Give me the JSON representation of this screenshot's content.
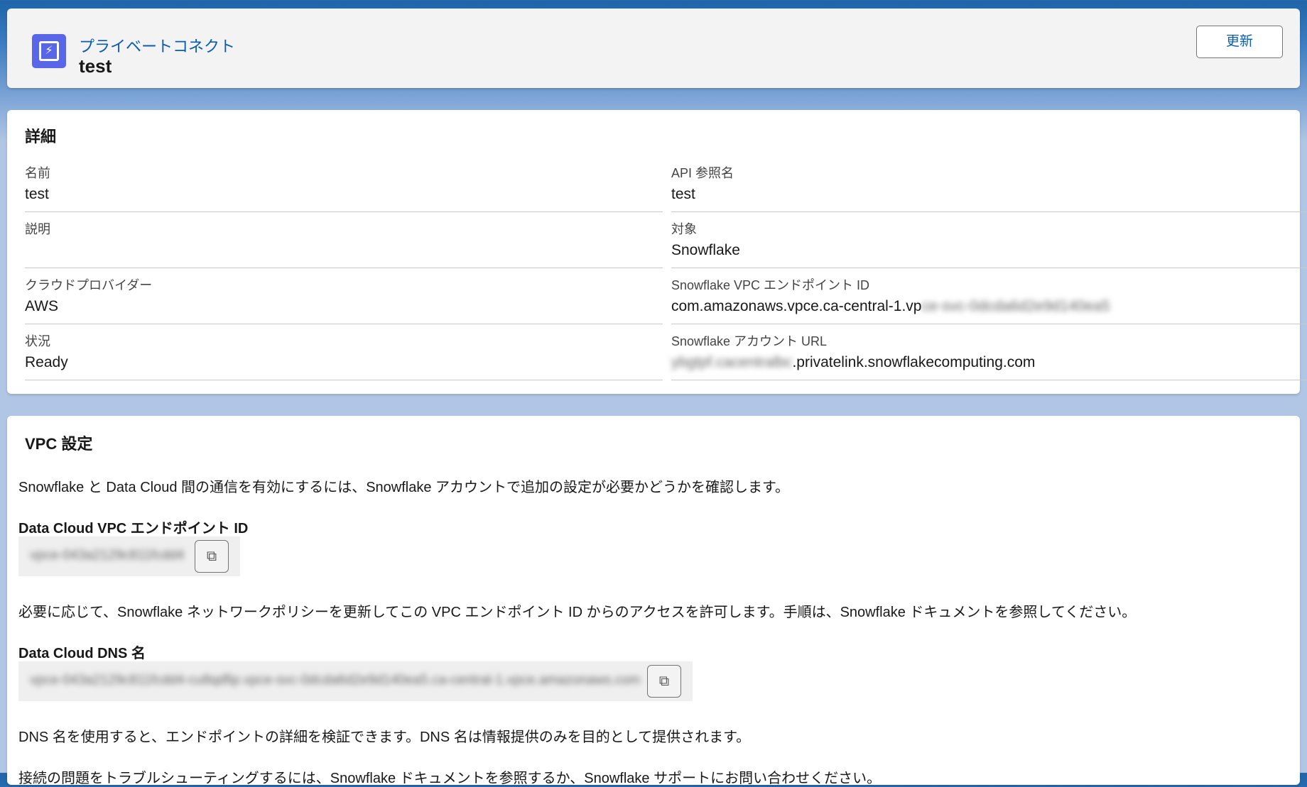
{
  "header": {
    "object_type": "プライベートコネクト",
    "title": "test",
    "update_button": "更新"
  },
  "details": {
    "title": "詳細",
    "left": [
      {
        "label": "名前",
        "value": "test"
      },
      {
        "label": "説明",
        "value": ""
      },
      {
        "label": "クラウドプロバイダー",
        "value": "AWS"
      },
      {
        "label": "状況",
        "value": "Ready"
      }
    ],
    "right": [
      {
        "label": "API 参照名",
        "value": "test"
      },
      {
        "label": "対象",
        "value": "Snowflake"
      },
      {
        "label": "Snowflake VPC エンドポイント ID",
        "value": "com.amazonaws.vpce.ca-central-1.vp",
        "value_blurred": "ce-svc-0dcda6d2e9d140ea5"
      },
      {
        "label": "Snowflake アカウント URL",
        "value_blurred": "ybgtpf.cacentralbc",
        "value": ".privatelink.snowflakecomputing.com"
      }
    ]
  },
  "vpc": {
    "title": "VPC 設定",
    "intro": "Snowflake と Data Cloud 間の通信を有効にするには、Snowflake アカウントで追加の設定が必要かどうかを確認します。",
    "endpoint_label": "Data Cloud VPC エンドポイント ID",
    "endpoint_value": "vpce-043a2129c811fcdd4",
    "endpoint_note": "必要に応じて、Snowflake ネットワークポリシーを更新してこの VPC エンドポイント ID からのアクセスを許可します。手順は、Snowflake ドキュメントを参照してください。",
    "dns_label": "Data Cloud DNS 名",
    "dns_value": "vpce-043a2129c811fcdd4-cu8qdfip.vpce-svc-0dcda6d2e9d140ea5.ca-central-1.vpce.amazonaws.com",
    "dns_note": "DNS 名を使用すると、エンドポイントの詳細を検証できます。DNS 名は情報提供のみを目的として提供されます。",
    "troubleshoot": "接続の問題をトラブルシューティングするには、Snowflake ドキュメントを参照するか、Snowflake サポートにお問い合わせください。"
  }
}
